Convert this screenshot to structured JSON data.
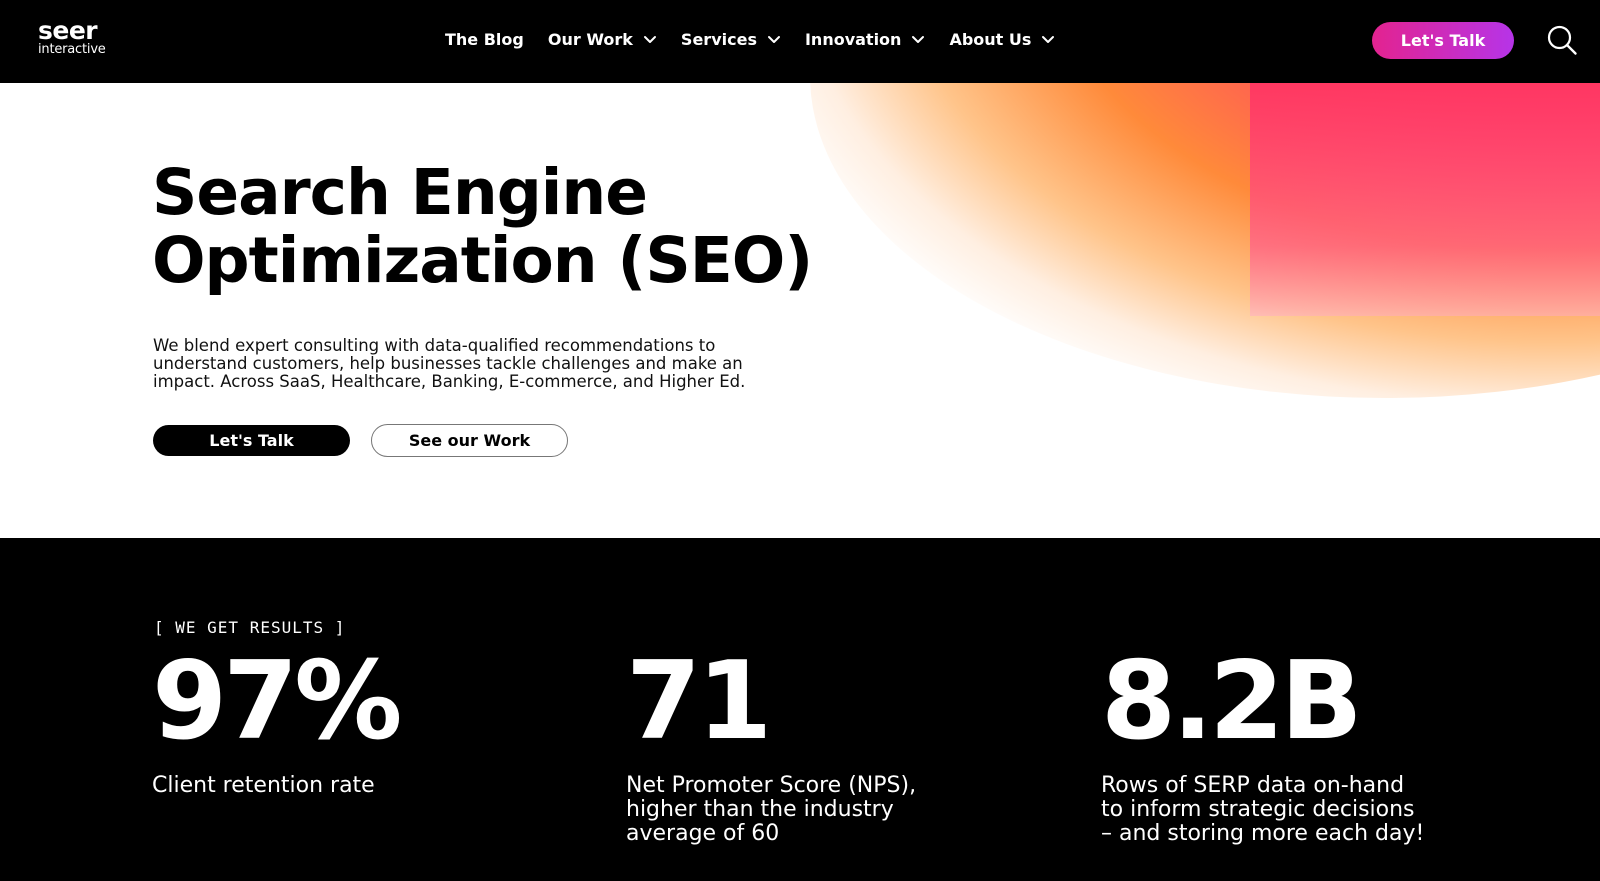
{
  "brand": {
    "logo_main": "seer",
    "logo_sub": "interactive"
  },
  "nav": {
    "items": [
      {
        "label": "The Blog",
        "has_dropdown": false
      },
      {
        "label": "Our Work",
        "has_dropdown": true
      },
      {
        "label": "Services",
        "has_dropdown": true
      },
      {
        "label": "Innovation",
        "has_dropdown": true
      },
      {
        "label": "About Us",
        "has_dropdown": true
      }
    ],
    "cta_label": "Let's Talk",
    "search_icon": "search-icon"
  },
  "hero": {
    "title_line1": "Search Engine",
    "title_line2": "Optimization (SEO)",
    "description": "We blend expert consulting with data-qualified recommendations to understand customers, help businesses tackle challenges and make an impact. Across SaaS, Healthcare, Banking, E-commerce, and Higher Ed.",
    "primary_button": "Let's Talk",
    "secondary_button": "See our Work"
  },
  "results": {
    "eyebrow": "[ WE GET RESULTS ]",
    "stats": [
      {
        "value": "97%",
        "label": "Client retention rate"
      },
      {
        "value": "71",
        "label": "Net Promoter Score (NPS), higher than the industry average of 60"
      },
      {
        "value": "8.2B",
        "label": "Rows of SERP data on-hand to inform strategic decisions – and storing more each day!"
      }
    ]
  },
  "colors": {
    "nav_bg": "#000000",
    "cta_gradient_start": "#e3238f",
    "cta_gradient_end": "#b634e8",
    "hero_gradient_orange": "#ff8a3a",
    "hero_gradient_pink": "#ff2c62",
    "stats_bg": "#000000"
  }
}
